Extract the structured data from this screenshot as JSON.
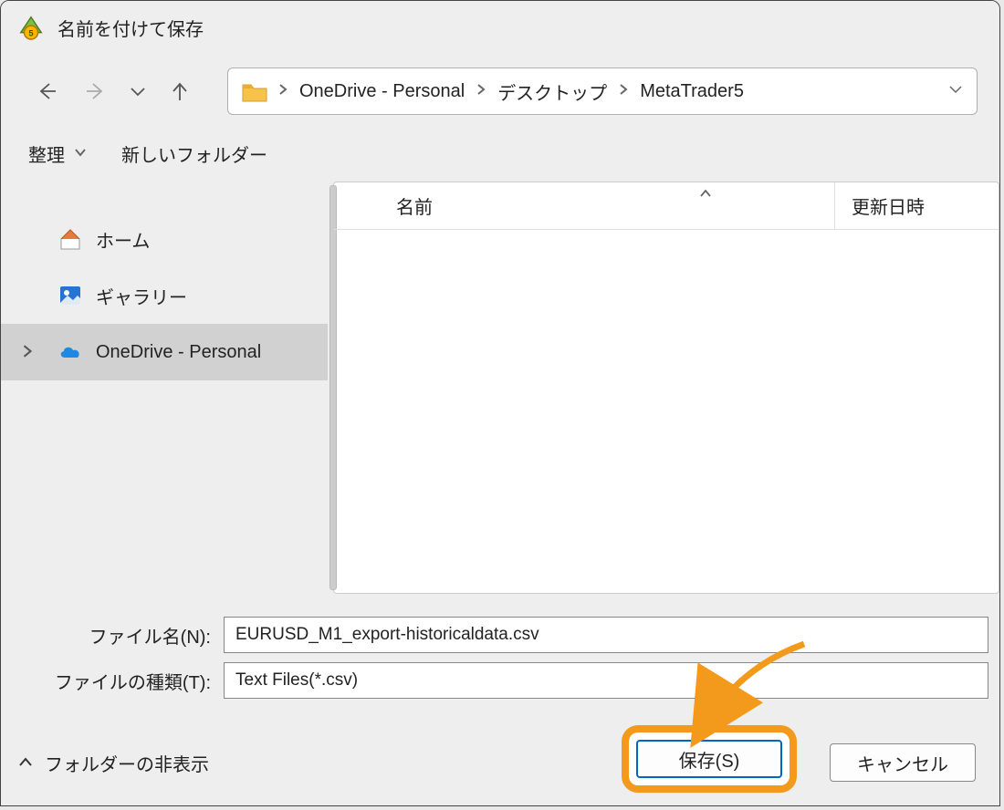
{
  "window": {
    "title": "名前を付けて保存"
  },
  "nav": {
    "breadcrumbs": [
      "OneDrive - Personal",
      "デスクトップ",
      "MetaTrader5"
    ]
  },
  "toolbar": {
    "organize": "整理",
    "new_folder": "新しいフォルダー"
  },
  "sidebar": {
    "home": "ホーム",
    "gallery": "ギャラリー",
    "onedrive": "OneDrive - Personal"
  },
  "filelist": {
    "columns": {
      "name": "名前",
      "date": "更新日時"
    }
  },
  "fields": {
    "filename_label": "ファイル名(N):",
    "filename_value": "EURUSD_M1_export-historicaldata.csv",
    "filetype_label": "ファイルの種類(T):",
    "filetype_value": "Text Files(*.csv)"
  },
  "footer": {
    "hide_folders": "フォルダーの非表示",
    "save": "保存(S)",
    "cancel": "キャンセル"
  }
}
